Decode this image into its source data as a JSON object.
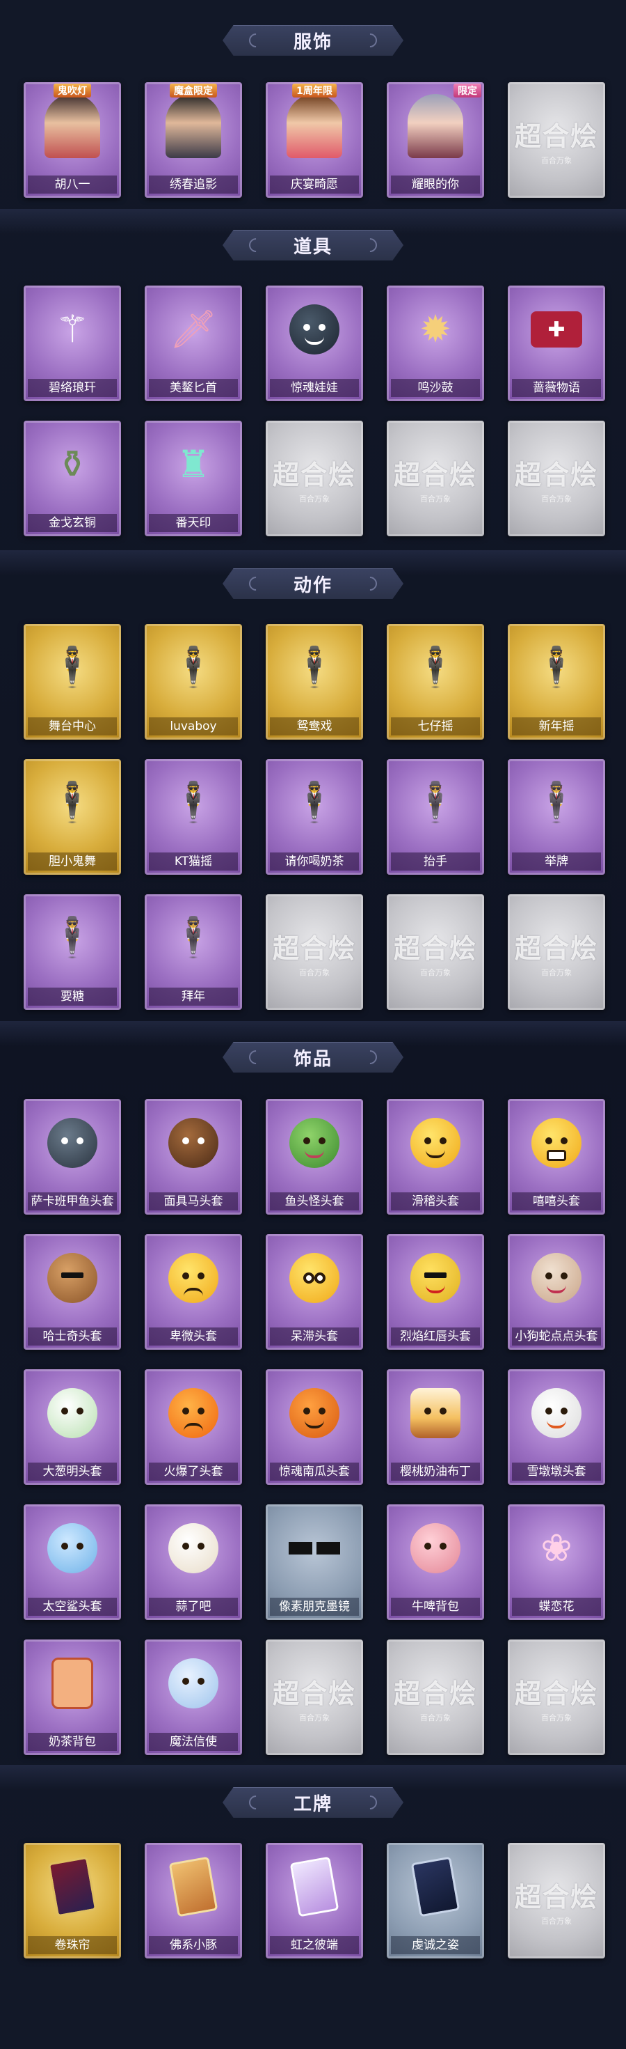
{
  "sections": {
    "clothing": {
      "title": "服饰",
      "items": [
        {
          "label": "胡八一",
          "badge": "鬼吹灯",
          "icon": "portrait-icon"
        },
        {
          "label": "绣春追影",
          "badge": "魔盒限定",
          "icon": "portrait-icon"
        },
        {
          "label": "庆宴畸愿",
          "badge": "1周年限",
          "icon": "portrait-icon"
        },
        {
          "label": "耀眼的你",
          "badge": "限定",
          "icon": "portrait-icon"
        },
        {
          "label": "",
          "icon": "locked-placeholder-icon"
        }
      ]
    },
    "props": {
      "title": "道具",
      "items": [
        {
          "label": "碧络琅玕",
          "icon": "staff-icon"
        },
        {
          "label": "美鳌匕首",
          "icon": "dagger-icon"
        },
        {
          "label": "惊魂娃娃",
          "icon": "skull-doll-icon"
        },
        {
          "label": "鸣沙鼓",
          "icon": "drum-icon"
        },
        {
          "label": "蔷薇物语",
          "icon": "box-icon"
        },
        {
          "label": "金戈玄铜",
          "icon": "lantern-icon"
        },
        {
          "label": "番天印",
          "icon": "seal-icon"
        },
        {
          "label": "",
          "icon": "locked-placeholder-icon"
        },
        {
          "label": "",
          "icon": "locked-placeholder-icon"
        },
        {
          "label": "",
          "icon": "locked-placeholder-icon"
        }
      ]
    },
    "actions": {
      "title": "动作",
      "items": [
        {
          "label": "舞台中心",
          "icon": "pose-icon",
          "tier": "gold"
        },
        {
          "label": "luvaboy",
          "icon": "pose-icon",
          "tier": "gold"
        },
        {
          "label": "鸳鸯戏",
          "icon": "pose-icon",
          "tier": "gold"
        },
        {
          "label": "七仔摇",
          "icon": "pose-icon",
          "tier": "gold"
        },
        {
          "label": "新年摇",
          "icon": "pose-icon",
          "tier": "gold"
        },
        {
          "label": "胆小鬼舞",
          "icon": "pose-icon",
          "tier": "gold"
        },
        {
          "label": "KT猫摇",
          "icon": "pose-icon",
          "tier": "purple"
        },
        {
          "label": "请你喝奶茶",
          "icon": "pose-icon",
          "tier": "purple"
        },
        {
          "label": "抬手",
          "icon": "pose-icon",
          "tier": "purple"
        },
        {
          "label": "举牌",
          "icon": "pose-icon",
          "tier": "purple"
        },
        {
          "label": "要糖",
          "icon": "pose-icon",
          "tier": "purple"
        },
        {
          "label": "拜年",
          "icon": "pose-icon",
          "tier": "purple"
        },
        {
          "label": "",
          "icon": "locked-placeholder-icon",
          "tier": "gray"
        },
        {
          "label": "",
          "icon": "locked-placeholder-icon",
          "tier": "gray"
        },
        {
          "label": "",
          "icon": "locked-placeholder-icon",
          "tier": "gray"
        }
      ]
    },
    "accessories": {
      "title": "饰品",
      "items": [
        {
          "label": "萨卡班甲鱼头套",
          "icon": "fish-head-icon",
          "tier": "purple"
        },
        {
          "label": "面具马头套",
          "icon": "horse-head-icon",
          "tier": "purple"
        },
        {
          "label": "鱼头怪头套",
          "icon": "fish-monster-icon",
          "tier": "purple"
        },
        {
          "label": "滑稽头套",
          "icon": "smile-face-icon",
          "tier": "purple"
        },
        {
          "label": "嘻嘻头套",
          "icon": "grin-face-icon",
          "tier": "purple"
        },
        {
          "label": "哈士奇头套",
          "icon": "dog-head-icon",
          "tier": "purple"
        },
        {
          "label": "卑微头套",
          "icon": "sad-face-icon",
          "tier": "purple"
        },
        {
          "label": "呆滞头套",
          "icon": "blank-face-icon",
          "tier": "purple"
        },
        {
          "label": "烈焰红唇头套",
          "icon": "pikachu-icon",
          "tier": "purple"
        },
        {
          "label": "小狗蛇点点头套",
          "icon": "snake-dog-icon",
          "tier": "purple"
        },
        {
          "label": "大葱明头套",
          "icon": "leek-icon",
          "tier": "purple"
        },
        {
          "label": "火爆了头套",
          "icon": "fire-face-icon",
          "tier": "purple"
        },
        {
          "label": "惊魂南瓜头套",
          "icon": "pumpkin-icon",
          "tier": "purple"
        },
        {
          "label": "樱桃奶油布丁",
          "icon": "pudding-icon",
          "tier": "purple"
        },
        {
          "label": "雪墩墩头套",
          "icon": "snowman-icon",
          "tier": "purple"
        },
        {
          "label": "太空鲨头套",
          "icon": "shark-head-icon",
          "tier": "purple"
        },
        {
          "label": "蒜了吧",
          "icon": "garlic-icon",
          "tier": "purple"
        },
        {
          "label": "像素朋克墨镜",
          "icon": "pixel-glasses-icon",
          "tier": "blue"
        },
        {
          "label": "牛啤背包",
          "icon": "cow-backpack-icon",
          "tier": "purple"
        },
        {
          "label": "蝶恋花",
          "icon": "butterfly-icon",
          "tier": "purple"
        },
        {
          "label": "奶茶背包",
          "icon": "milktea-bag-icon",
          "tier": "purple"
        },
        {
          "label": "魔法信使",
          "icon": "elephant-icon",
          "tier": "purple"
        },
        {
          "label": "",
          "icon": "locked-placeholder-icon",
          "tier": "gray"
        },
        {
          "label": "",
          "icon": "locked-placeholder-icon",
          "tier": "gray"
        },
        {
          "label": "",
          "icon": "locked-placeholder-icon",
          "tier": "gray"
        }
      ]
    },
    "badges": {
      "title": "工牌",
      "items": [
        {
          "label": "卷珠帘",
          "icon": "card-icon",
          "tier": "gold"
        },
        {
          "label": "佛系小豚",
          "icon": "card-icon",
          "tier": "purple"
        },
        {
          "label": "虹之彼端",
          "icon": "card-icon",
          "tier": "purple"
        },
        {
          "label": "虔诚之姿",
          "icon": "card-icon",
          "tier": "blue"
        },
        {
          "label": "",
          "icon": "locked-placeholder-icon",
          "tier": "gray"
        }
      ]
    }
  },
  "placeholder": {
    "main": "超合烩",
    "sub": "百合万象"
  }
}
